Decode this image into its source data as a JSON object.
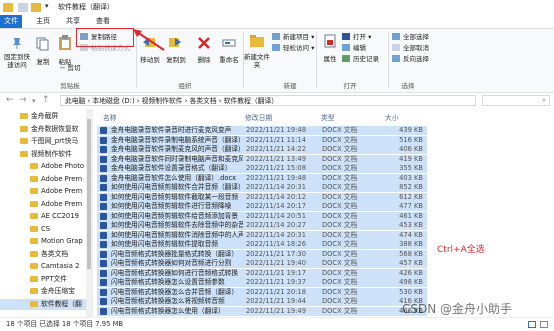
{
  "window": {
    "title": "软件教程（翻译）"
  },
  "tabs": [
    {
      "label": "文件"
    },
    {
      "label": "主页"
    },
    {
      "label": "共享"
    },
    {
      "label": "查看"
    }
  ],
  "ribbon": {
    "pin_label": "固定到快速访问",
    "copy_label": "复制",
    "paste_label": "粘贴",
    "copy_path_label": "复制路径",
    "paste_shortcut_label": "粘贴快捷方式",
    "cut_label": "剪切",
    "clipboard_group": "剪贴板",
    "move_to_label": "移动到",
    "copy_to_label": "复制到",
    "delete_label": "删除",
    "rename_label": "重命名",
    "organize_group": "组织",
    "new_item_label": "新建项目",
    "easy_access_label": "轻松访问",
    "new_folder_label": "新建文件夹",
    "new_group": "新建",
    "properties_label": "属性",
    "open_label": "打开",
    "edit_label": "编辑",
    "history_label": "历史记录",
    "open_group": "打开",
    "select_all_label": "全部选择",
    "select_none_label": "全部取消",
    "invert_label": "反向选择",
    "select_group": "选择"
  },
  "address": {
    "path": "此电脑 › 本地磁盘 (D:) › 视频制作软件 › 各类文档 › 软件教程（翻译）"
  },
  "sidebar": {
    "items": [
      {
        "label": "金舟截屏"
      },
      {
        "label": "金舟数据恢复软"
      },
      {
        "label": "千图网_prt快马"
      },
      {
        "label": "视频制作软件"
      },
      {
        "label": "Adobe Photo"
      },
      {
        "label": "Adobe Prem"
      },
      {
        "label": "Adobe Prem"
      },
      {
        "label": "Adobe Prem"
      },
      {
        "label": "AE CC2019"
      },
      {
        "label": "CS"
      },
      {
        "label": "Motion Grap"
      },
      {
        "label": "各类文档"
      },
      {
        "label": "Camtasia 2"
      },
      {
        "label": "PPT文件"
      },
      {
        "label": "金舟压缩宝"
      },
      {
        "label": "软件教程（翻"
      }
    ]
  },
  "columns": {
    "name": "名称",
    "date": "修改日期",
    "type": "类型",
    "size": "大小"
  },
  "files": [
    {
      "name": "金舟电脑录音软件录音时进行麦克风变声",
      "date": "2022/11/21 19:48",
      "type": "DOCX 文档",
      "size": "439 KB"
    },
    {
      "name": "金舟电脑录音软件录制电脑系统声音（翻译）",
      "date": "2022/11/21 11:14",
      "type": "DOCX 文档",
      "size": "516 KB"
    },
    {
      "name": "金舟电脑录音软件录制麦克风的声音（翻译）",
      "date": "2022/11/21 14:22",
      "type": "DOCX 文档",
      "size": "406 KB"
    },
    {
      "name": "金舟电脑录音软件同时录制电脑声音和麦克风",
      "date": "2022/11/21 13:49",
      "type": "DOCX 文档",
      "size": "419 KB"
    },
    {
      "name": "金舟电脑录音软件设置录音格式（翻译）",
      "date": "2022/11/21 15:08",
      "type": "DOCX 文档",
      "size": "355 KB"
    },
    {
      "name": "金舟电脑录音软件怎么使用（翻译）.docx",
      "date": "2022/11/21 19:48",
      "type": "DOCX 文档",
      "size": "403 KB"
    },
    {
      "name": "如何使用闪电音频剪辑软件合并音频（翻译）",
      "date": "2022/11/14 20:31",
      "type": "DOCX 文档",
      "size": "852 KB"
    },
    {
      "name": "如何使用闪电音频剪辑软件截取某一段音频",
      "date": "2022/11/14 20:12",
      "type": "DOCX 文档",
      "size": "612 KB"
    },
    {
      "name": "如何使用闪电音频剪辑软件进行音频降噪",
      "date": "2022/11/14 20:17",
      "type": "DOCX 文档",
      "size": "477 KB"
    },
    {
      "name": "如何使用闪电音频剪辑软件给音频添加背景",
      "date": "2022/11/14 20:51",
      "type": "DOCX 文档",
      "size": "461 KB"
    },
    {
      "name": "如何使用闪电音频剪辑软件去除音频中的杂音",
      "date": "2022/11/14 20:27",
      "type": "DOCX 文档",
      "size": "453 KB"
    },
    {
      "name": "如何使用闪电音频剪辑软件消除音频中的人声",
      "date": "2022/11/14 20:31",
      "type": "DOCX 文档",
      "size": "474 KB"
    },
    {
      "name": "如何使用闪电音频剪辑软件提取音频",
      "date": "2022/11/14 18:26",
      "type": "DOCX 文档",
      "size": "388 KB"
    },
    {
      "name": "闪电音频格式转换器批量格式转换（翻译）",
      "date": "2022/11/21 17:30",
      "type": "DOCX 文档",
      "size": "568 KB"
    },
    {
      "name": "闪电音频格式转换器如何对音频进行分割",
      "date": "2022/11/21 19:40",
      "type": "DOCX 文档",
      "size": "457 KB"
    },
    {
      "name": "闪电音频格式转换器如何进行音频格式转换",
      "date": "2022/11/21 19:17",
      "type": "DOCX 文档",
      "size": "426 KB"
    },
    {
      "name": "闪电音频格式转换器怎么设置音频参数",
      "date": "2022/11/21 19:37",
      "type": "DOCX 文档",
      "size": "498 KB"
    },
    {
      "name": "闪电音频格式转换器怎么合并音频（翻译）",
      "date": "2022/11/21 20:18",
      "type": "DOCX 文档",
      "size": "530 KB"
    },
    {
      "name": "闪电音频格式转换器怎么将视频转音频",
      "date": "2022/11/21 19:44",
      "type": "DOCX 文档",
      "size": "416 KB"
    },
    {
      "name": "闪电音频格式转换器怎么使用（翻译）",
      "date": "2022/11/21 19:49",
      "type": "DOCX 文档",
      "size": "466 KB"
    }
  ],
  "status": {
    "text": "18 个项目    已选择 18 个项目  7.95 MB"
  },
  "annotation": {
    "text": "Ctrl+A全选"
  },
  "watermark": {
    "text": "CSDN @金舟小助手"
  }
}
